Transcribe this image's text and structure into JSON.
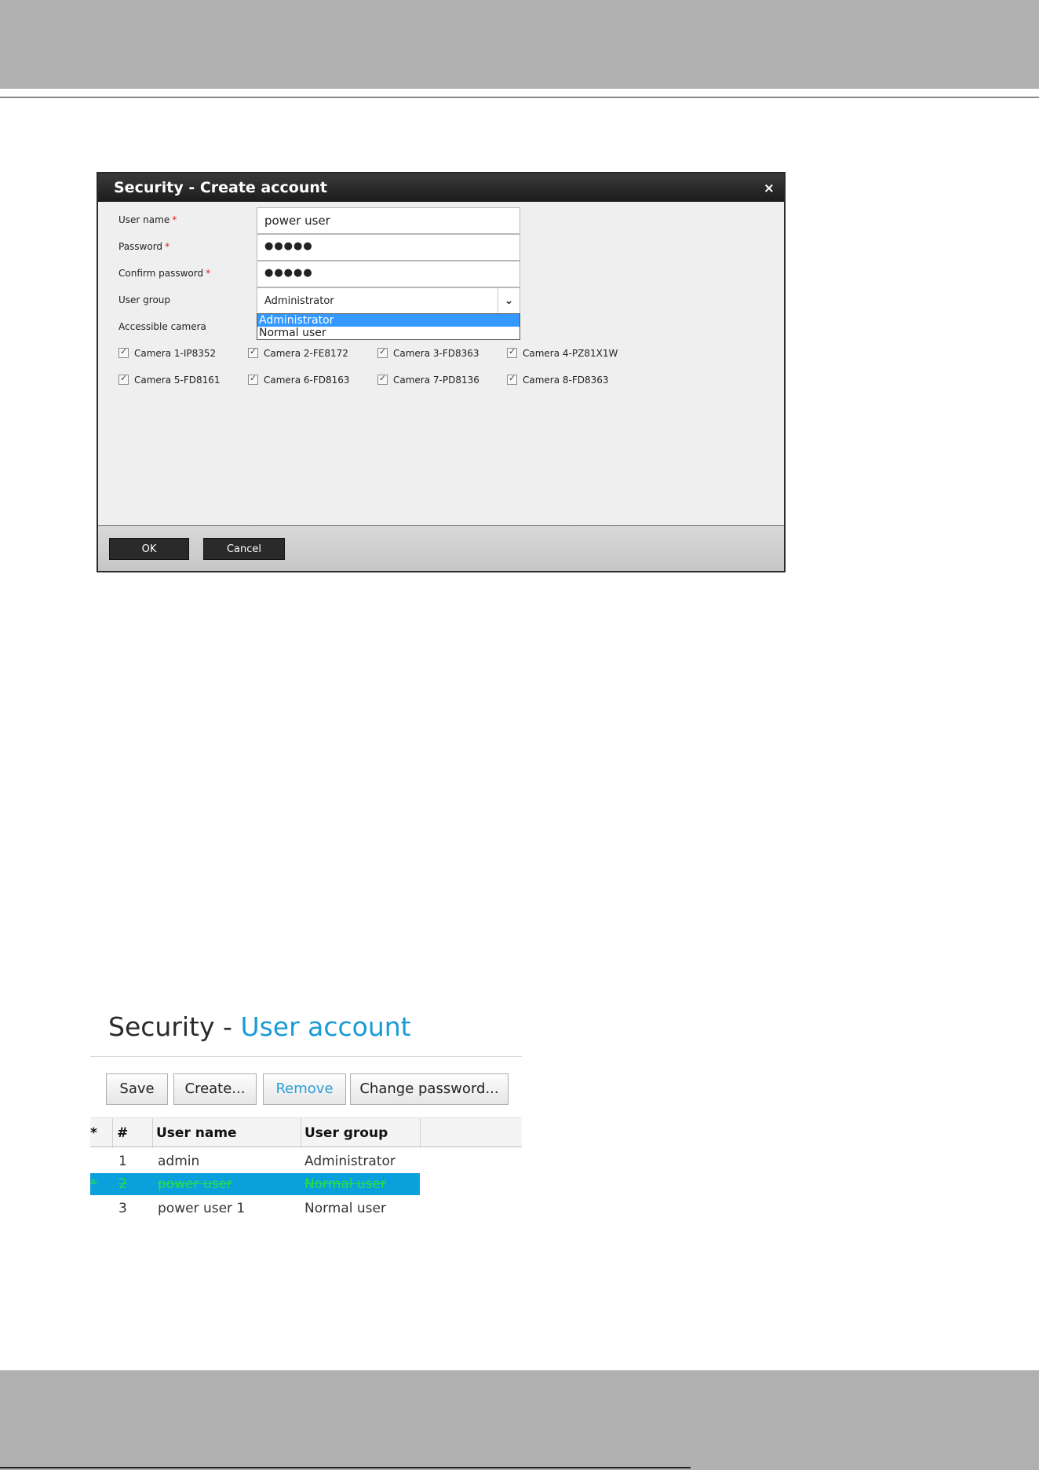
{
  "dialog": {
    "title": "Security - Create account",
    "close_glyph": "×",
    "fields": {
      "username_label": "User name",
      "username_value": "power user",
      "password_label": "Password",
      "password_value": "●●●●●",
      "confirm_label": "Confirm password",
      "confirm_value": "●●●●●",
      "usergroup_label": "User group",
      "usergroup_value": "Administrator",
      "required_mark": "*"
    },
    "usergroup_options": [
      "Administrator",
      "Normal user"
    ],
    "accessible_camera_label": "Accessible camera",
    "cameras": [
      {
        "label": "Camera 1-IP8352",
        "checked": true
      },
      {
        "label": "Camera 2-FE8172",
        "checked": true
      },
      {
        "label": "Camera 3-FD8363",
        "checked": true
      },
      {
        "label": "Camera 4-PZ81X1W",
        "checked": true
      },
      {
        "label": "Camera 5-FD8161",
        "checked": true
      },
      {
        "label": "Camera 6-FD8163",
        "checked": true
      },
      {
        "label": "Camera 7-PD8136",
        "checked": true
      },
      {
        "label": "Camera 8-FD8363",
        "checked": true
      }
    ],
    "ok_label": "OK",
    "cancel_label": "Cancel"
  },
  "account_panel": {
    "title_prefix": "Security",
    "title_sep": "-",
    "title_accent": "User account",
    "toolbar": {
      "save": "Save",
      "create": "Create...",
      "remove": "Remove",
      "change_password": "Change password..."
    },
    "columns": [
      "*",
      "#",
      "User name",
      "User group"
    ],
    "rows": [
      {
        "mark": "",
        "num": "1",
        "name": "admin",
        "group": "Administrator",
        "selected": false
      },
      {
        "mark": "*",
        "num": "2",
        "name": "power user",
        "group": "Normal user",
        "selected": true
      },
      {
        "mark": "",
        "num": "3",
        "name": "power user 1",
        "group": "Normal user",
        "selected": false
      }
    ]
  },
  "colors": {
    "accent": "#1a9ad6",
    "selection": "#0aa0dc",
    "pending_text": "#22e04a",
    "dropdown_highlight": "#3399ff"
  }
}
